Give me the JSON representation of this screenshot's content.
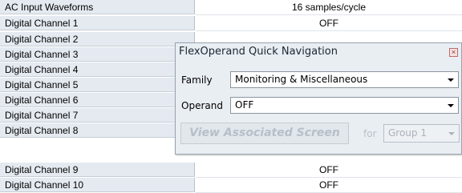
{
  "settings": {
    "rows": [
      {
        "label": "AC Input Waveforms",
        "value": "16 samples/cycle"
      },
      {
        "label": "Digital Channel 1",
        "value": "OFF"
      },
      {
        "label": "Digital Channel 2",
        "value": ""
      },
      {
        "label": "Digital Channel 3",
        "value": ""
      },
      {
        "label": "Digital Channel 4",
        "value": ""
      },
      {
        "label": "Digital Channel 5",
        "value": ""
      },
      {
        "label": "Digital Channel 6",
        "value": ""
      },
      {
        "label": "Digital Channel 7",
        "value": ""
      },
      {
        "label": "Digital Channel 8",
        "value": ""
      },
      {
        "label": "Digital Channel 9",
        "value": "OFF"
      },
      {
        "label": "Digital Channel 10",
        "value": "OFF"
      }
    ]
  },
  "dialog": {
    "title": "FlexOperand Quick Navigation",
    "close_icon": "close-icon",
    "family_label": "Family",
    "family_value": "Monitoring & Miscellaneous",
    "operand_label": "Operand",
    "operand_value": "OFF",
    "view_button": "View Associated Screen",
    "for_label": "for",
    "group_value": "Group 1"
  }
}
